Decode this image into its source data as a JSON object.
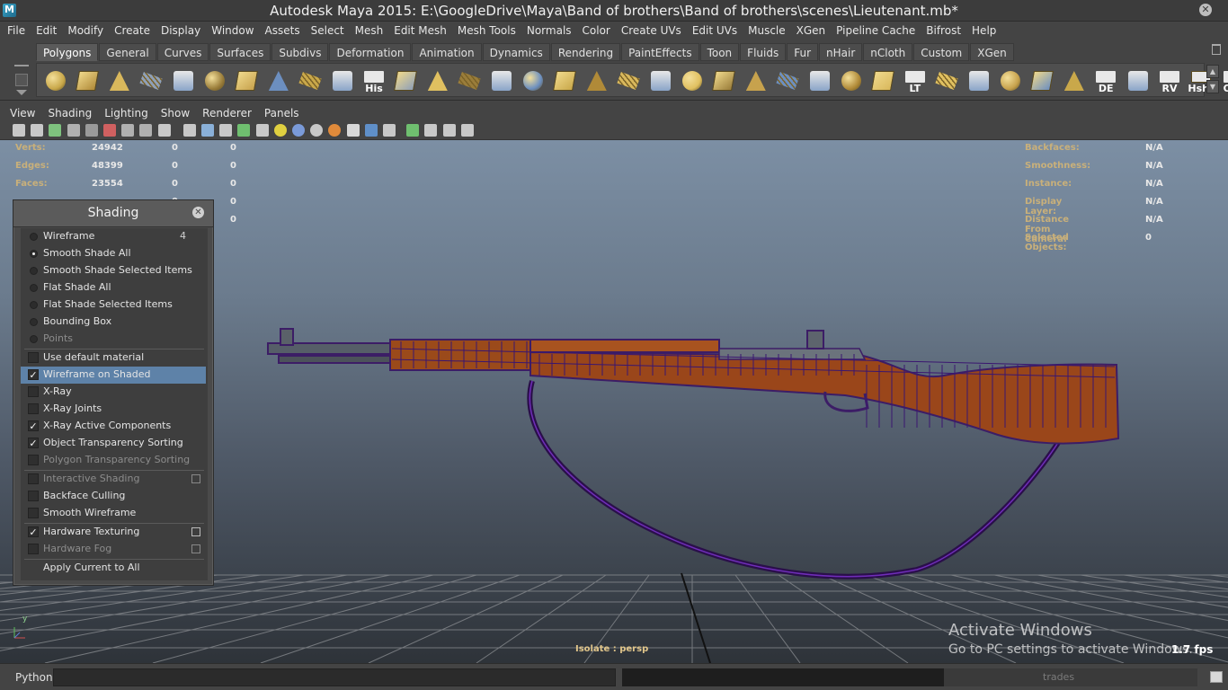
{
  "window": {
    "title": "Autodesk Maya 2015: E:\\GoogleDrive\\Maya\\Band of brothers\\Band of brothers\\scenes\\Lieutenant.mb*",
    "close_glyph": "✕"
  },
  "menubar": [
    "File",
    "Edit",
    "Modify",
    "Create",
    "Display",
    "Window",
    "Assets",
    "Select",
    "Mesh",
    "Edit Mesh",
    "Mesh Tools",
    "Normals",
    "Color",
    "Create UVs",
    "Edit UVs",
    "Muscle",
    "XGen",
    "Pipeline Cache",
    "Bifrost",
    "Help"
  ],
  "shelf": {
    "tabs": [
      "Polygons",
      "General",
      "Curves",
      "Surfaces",
      "Subdivs",
      "Deformation",
      "Animation",
      "Dynamics",
      "Rendering",
      "PaintEffects",
      "Toon",
      "Fluids",
      "Fur",
      "nHair",
      "nCloth",
      "Custom",
      "XGen"
    ],
    "active_tab": "Polygons",
    "icons": [
      {
        "name": "poly-sphere-icon",
        "label": ""
      },
      {
        "name": "poly-cube-icon",
        "label": ""
      },
      {
        "name": "poly-cylinder-icon",
        "label": ""
      },
      {
        "name": "poly-cone-icon",
        "label": ""
      },
      {
        "name": "poly-plane-icon",
        "label": ""
      },
      {
        "name": "poly-torus-icon",
        "label": ""
      },
      {
        "name": "poly-pyramid-icon",
        "label": ""
      },
      {
        "name": "poly-pipe-icon",
        "label": ""
      },
      {
        "name": "create-polygon-tool-icon",
        "label": ""
      },
      {
        "name": "sculpt-geometry-icon",
        "label": ""
      },
      {
        "name": "history-icon",
        "label": "His"
      },
      {
        "name": "combine-icon",
        "label": ""
      },
      {
        "name": "extrude-icon",
        "label": ""
      },
      {
        "name": "split-polygon-icon",
        "label": ""
      },
      {
        "name": "bridge-icon",
        "label": ""
      },
      {
        "name": "append-polygon-icon",
        "label": ""
      },
      {
        "name": "merge-vertices-icon",
        "label": ""
      },
      {
        "name": "bevel-icon",
        "label": ""
      },
      {
        "name": "insert-edge-loop-icon",
        "label": ""
      },
      {
        "name": "planar-mapping-icon",
        "label": ""
      },
      {
        "name": "uv-editor-icon",
        "label": ""
      },
      {
        "name": "sculpt-tool-icon",
        "label": ""
      },
      {
        "name": "paint-tool-icon",
        "label": ""
      },
      {
        "name": "lattice-icon",
        "label": ""
      },
      {
        "name": "transform-icon",
        "label": ""
      },
      {
        "name": "rotate-icon",
        "label": ""
      },
      {
        "name": "cube-blue-icon",
        "label": ""
      },
      {
        "name": "layout-uv-icon",
        "label": "LT"
      },
      {
        "name": "unfold-uv-icon",
        "label": ""
      },
      {
        "name": "smooth-uv-icon",
        "label": ""
      },
      {
        "name": "cut-uv-icon",
        "label": ""
      },
      {
        "name": "sew-uv-icon",
        "label": ""
      },
      {
        "name": "move-sew-uv-icon",
        "label": ""
      },
      {
        "name": "delete-edge-icon",
        "label": "DE"
      },
      {
        "name": "grid-uv-icon",
        "label": ""
      },
      {
        "name": "reverse-normals-icon",
        "label": "RV"
      },
      {
        "name": "hard-soft-shade-icon",
        "label": "Hshd"
      },
      {
        "name": "outliner-icon",
        "label": "Out"
      }
    ]
  },
  "panel_menu": [
    "View",
    "Shading",
    "Lighting",
    "Show",
    "Renderer",
    "Panels"
  ],
  "hud": {
    "left": [
      {
        "label": "Verts:",
        "v1": "24942",
        "v2": "0",
        "v3": "0"
      },
      {
        "label": "Edges:",
        "v1": "48399",
        "v2": "0",
        "v3": "0"
      },
      {
        "label": "Faces:",
        "v1": "23554",
        "v2": "0",
        "v3": "0"
      },
      {
        "label": "",
        "v1": "",
        "v2": "0",
        "v3": "0"
      },
      {
        "label": "",
        "v1": "",
        "v2": "",
        "v3": "0"
      }
    ],
    "right": [
      {
        "label": "Backfaces:",
        "value": "N/A"
      },
      {
        "label": "Smoothness:",
        "value": "N/A"
      },
      {
        "label": "Instance:",
        "value": "N/A"
      },
      {
        "label": "Display Layer:",
        "value": "N/A"
      },
      {
        "label": "Distance From Camera:",
        "value": "N/A"
      },
      {
        "label": "Selected Objects:",
        "value": "0"
      }
    ],
    "isolate": "Isolate : persp",
    "fps": "1.7 fps",
    "axis_y": "y"
  },
  "watermark": {
    "line1": "Activate Windows",
    "line2": "Go to PC settings to activate Windows."
  },
  "shading_panel": {
    "title": "Shading",
    "close_glyph": "✕",
    "check_glyph": "✓",
    "items": [
      {
        "label": "Wireframe",
        "kind": "radio",
        "on": false,
        "shortcut": "4"
      },
      {
        "label": "Smooth Shade All",
        "kind": "radio",
        "on": true
      },
      {
        "label": "Smooth Shade Selected Items",
        "kind": "radio",
        "on": false
      },
      {
        "label": "Flat Shade All",
        "kind": "radio",
        "on": false
      },
      {
        "label": "Flat Shade Selected Items",
        "kind": "radio",
        "on": false
      },
      {
        "label": "Bounding Box",
        "kind": "radio",
        "on": false
      },
      {
        "label": "Points",
        "kind": "radio",
        "on": false,
        "disabled": true
      },
      {
        "label": "Use default material",
        "kind": "check",
        "on": false
      },
      {
        "label": "Wireframe on Shaded",
        "kind": "check",
        "on": true,
        "selected": true
      },
      {
        "label": "X-Ray",
        "kind": "check",
        "on": false
      },
      {
        "label": "X-Ray Joints",
        "kind": "check",
        "on": false
      },
      {
        "label": "X-Ray Active Components",
        "kind": "check",
        "on": true
      },
      {
        "label": "Object Transparency Sorting",
        "kind": "check",
        "on": true
      },
      {
        "label": "Polygon Transparency Sorting",
        "kind": "check",
        "on": false,
        "disabled": true
      },
      {
        "label": "Interactive Shading",
        "kind": "check",
        "on": false,
        "disabled": true,
        "option": true
      },
      {
        "label": "Backface Culling",
        "kind": "check",
        "on": false
      },
      {
        "label": "Smooth Wireframe",
        "kind": "check",
        "on": false
      },
      {
        "label": "Hardware Texturing",
        "kind": "check",
        "on": true,
        "option": true
      },
      {
        "label": "Hardware Fog",
        "kind": "check",
        "on": false,
        "disabled": true,
        "option": true
      },
      {
        "label": "Apply Current to All",
        "kind": "action"
      }
    ]
  },
  "command_line": {
    "language": "Python",
    "result_hint": "trades"
  }
}
